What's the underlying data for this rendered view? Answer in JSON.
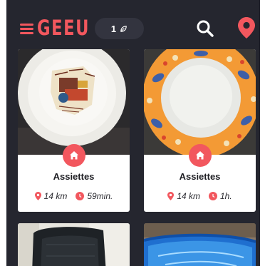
{
  "app": {
    "logo_text": "GEEU",
    "brand_color": "#f2575e",
    "background_color": "#25262f",
    "pill_color": "#33343f"
  },
  "header": {
    "menu_icon": "hamburger-menu-icon",
    "counter_value": "1",
    "counter_icon": "leaf-icon",
    "search_icon": "search-icon",
    "location_icon": "location-pin-icon"
  },
  "items": [
    {
      "title": "Assiettes",
      "distance": "14 km",
      "time": "59min.",
      "badge_icon": "home-icon",
      "image": "decorated white plate"
    },
    {
      "title": "Assiettes",
      "distance": "14 km",
      "time": "1h.",
      "badge_icon": "home-icon",
      "image": "plate with orange floral rim"
    },
    {
      "image": "black leather office chair"
    },
    {
      "image": "blue inflatable pool"
    }
  ]
}
